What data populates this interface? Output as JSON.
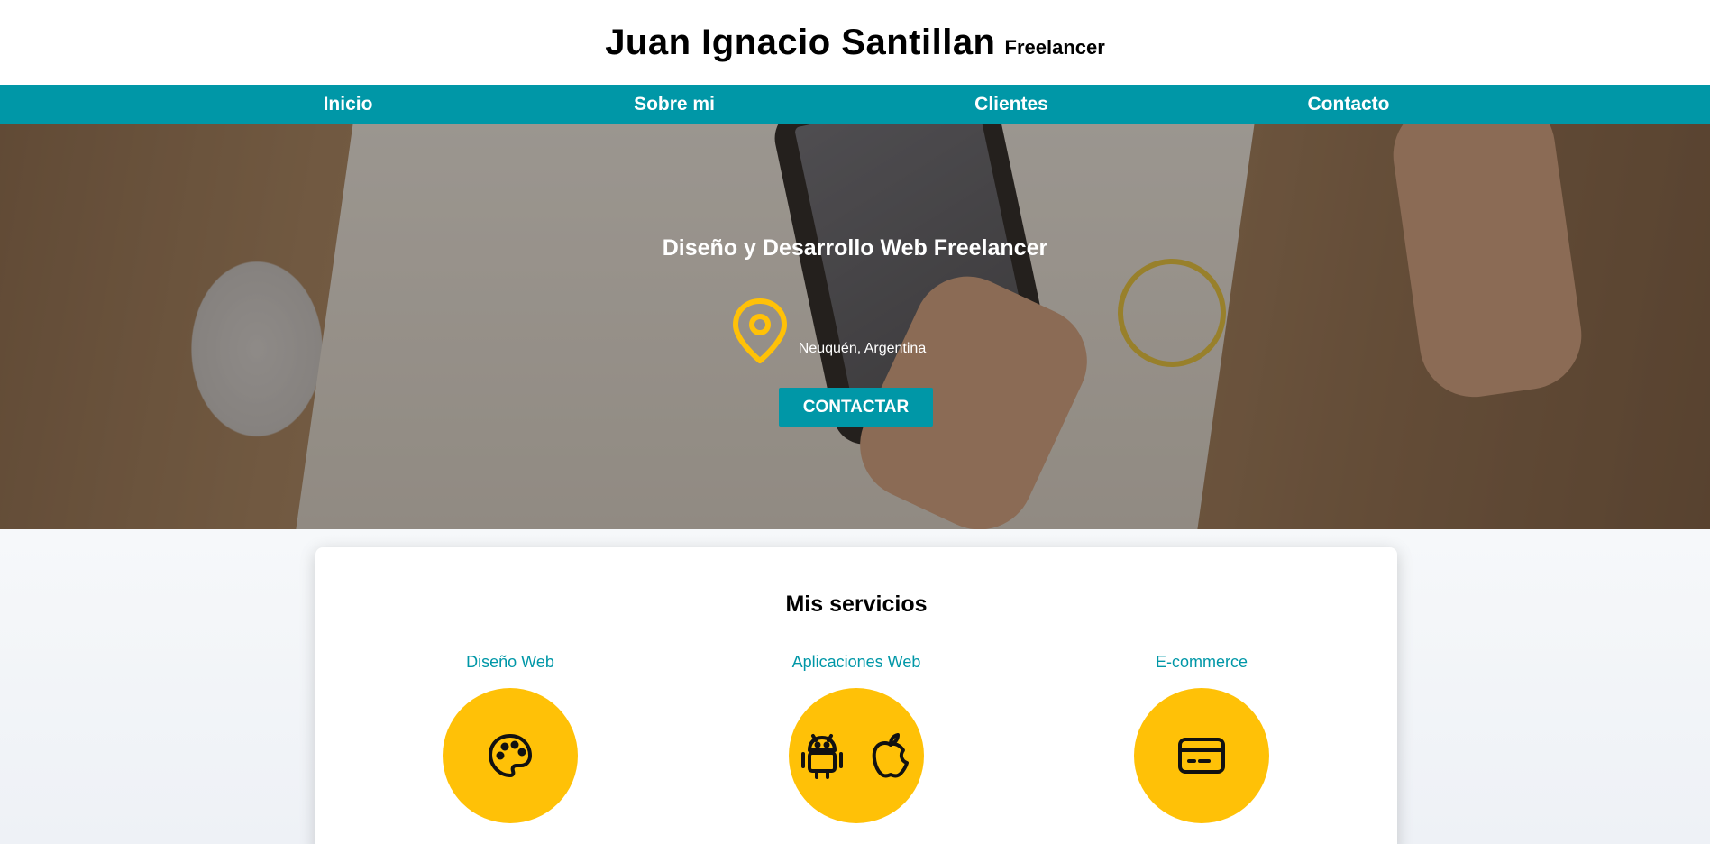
{
  "header": {
    "name": "Juan Ignacio Santillan",
    "subtitle": "Freelancer"
  },
  "nav": {
    "items": [
      "Inicio",
      "Sobre mi",
      "Clientes",
      "Contacto"
    ]
  },
  "hero": {
    "title": "Diseño y Desarrollo Web Freelancer",
    "location": "Neuquén, Argentina",
    "cta_label": "CONTACTAR"
  },
  "services": {
    "title": "Mis servicios",
    "items": [
      {
        "name": "Diseño Web",
        "icon": "palette-icon"
      },
      {
        "name": "Aplicaciones Web",
        "icon": "android-icon apple-icon"
      },
      {
        "name": "E-commerce",
        "icon": "credit-card-icon"
      }
    ]
  },
  "colors": {
    "accent": "#0097a7",
    "highlight": "#ffc107"
  }
}
